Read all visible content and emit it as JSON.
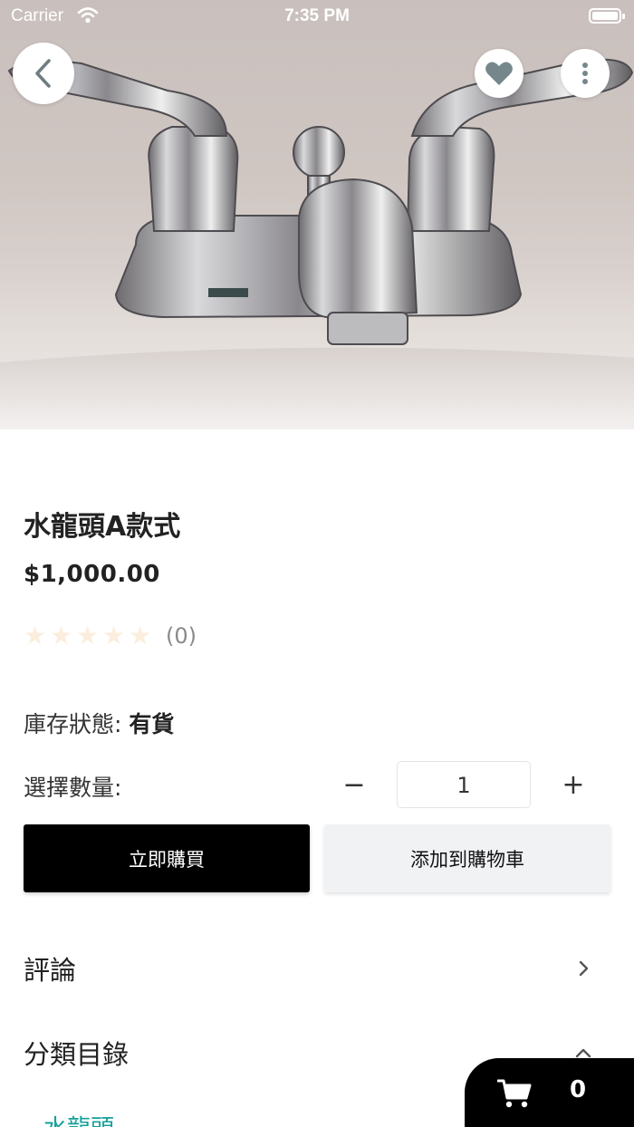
{
  "status_bar": {
    "carrier": "Carrier",
    "time": "7:35 PM"
  },
  "header": {
    "back_icon": "chevron-left-icon",
    "favorite_icon": "heart-icon",
    "more_icon": "more-vertical-icon"
  },
  "product": {
    "title": "水龍頭A款式",
    "price": "$1,000.00",
    "rating": {
      "stars_filled": 0,
      "stars_total": 5,
      "count_label": "(0)"
    },
    "stock_label": "庫存狀態:",
    "stock_value": "有貨"
  },
  "quantity": {
    "label": "選擇數量:",
    "minus": "−",
    "value": "1",
    "plus": "+"
  },
  "actions": {
    "buy_now": "立即購買",
    "add_to_cart": "添加到購物車"
  },
  "sections": {
    "reviews": "評論",
    "category": "分類目錄"
  },
  "category_link": "水龍頭",
  "cart": {
    "count": "0",
    "icon": "cart-icon"
  },
  "colors": {
    "accent_teal": "#16a09a",
    "star_empty": "#fbeedd",
    "button_dark": "#000000",
    "button_light": "#f1f2f4"
  }
}
